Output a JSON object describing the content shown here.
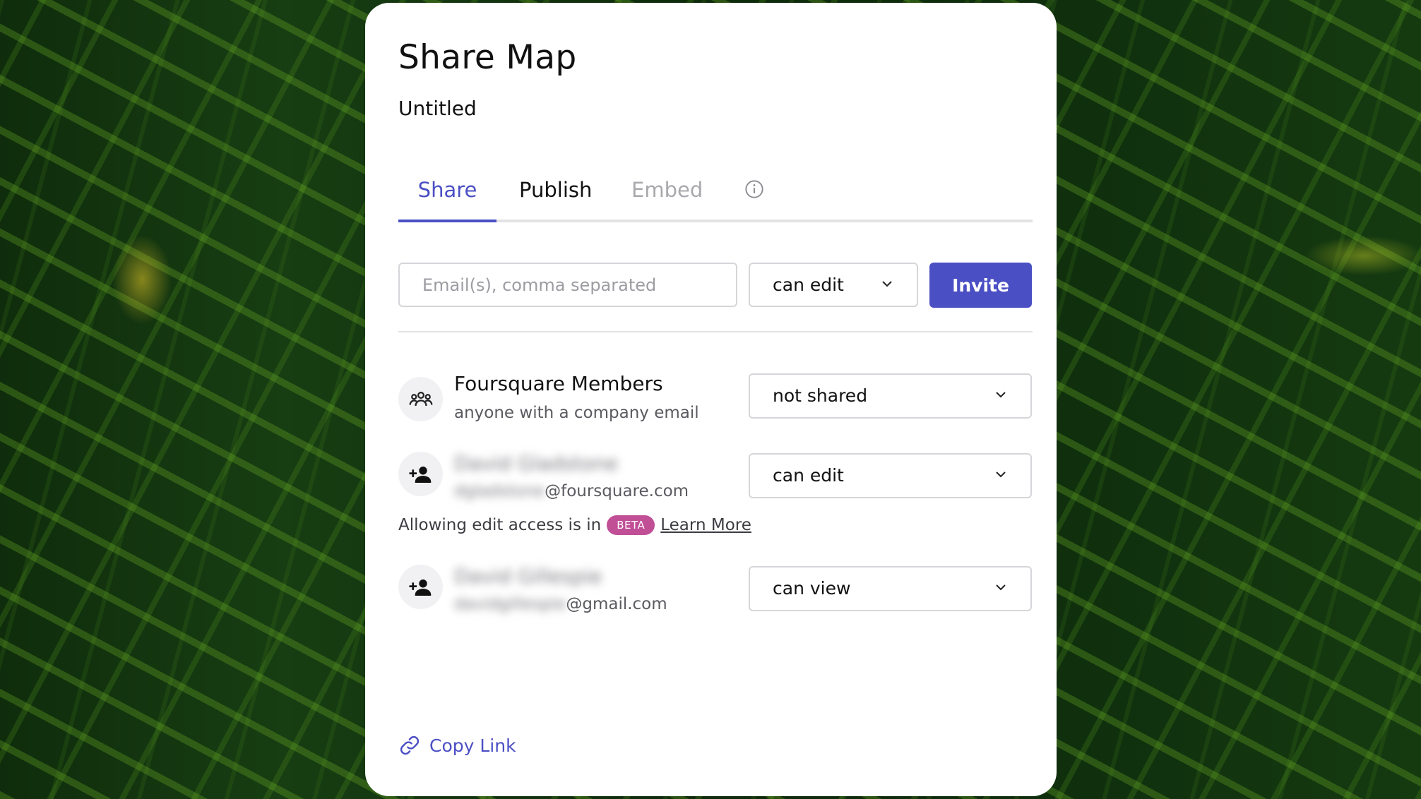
{
  "modal": {
    "title": "Share Map",
    "subtitle": "Untitled"
  },
  "tabs": [
    {
      "label": "Share",
      "active": true
    },
    {
      "label": "Publish",
      "active": false
    },
    {
      "label": "Embed",
      "active": false,
      "disabled": true
    }
  ],
  "invite": {
    "email_placeholder": "Email(s), comma separated",
    "permission": "can edit",
    "button_label": "Invite"
  },
  "members": [
    {
      "icon": "group-icon",
      "name": "Foursquare Members",
      "detail": "anyone with a company email",
      "permission": "not shared"
    },
    {
      "icon": "person-add-icon",
      "name": "David Gladstone",
      "email_user": "dgladstone",
      "email_domain": "@foursquare.com",
      "permission": "can edit"
    },
    {
      "icon": "person-add-icon",
      "name": "David Gillespie",
      "email_user": "davidgillespie",
      "email_domain": "@gmail.com",
      "permission": "can view"
    }
  ],
  "beta_notice": {
    "text": "Allowing edit access is in",
    "badge": "BETA",
    "link": "Learn More"
  },
  "footer": {
    "copy_link_label": "Copy Link"
  },
  "colors": {
    "accent": "#4b4fc4",
    "beta_badge": "#c04f96"
  }
}
